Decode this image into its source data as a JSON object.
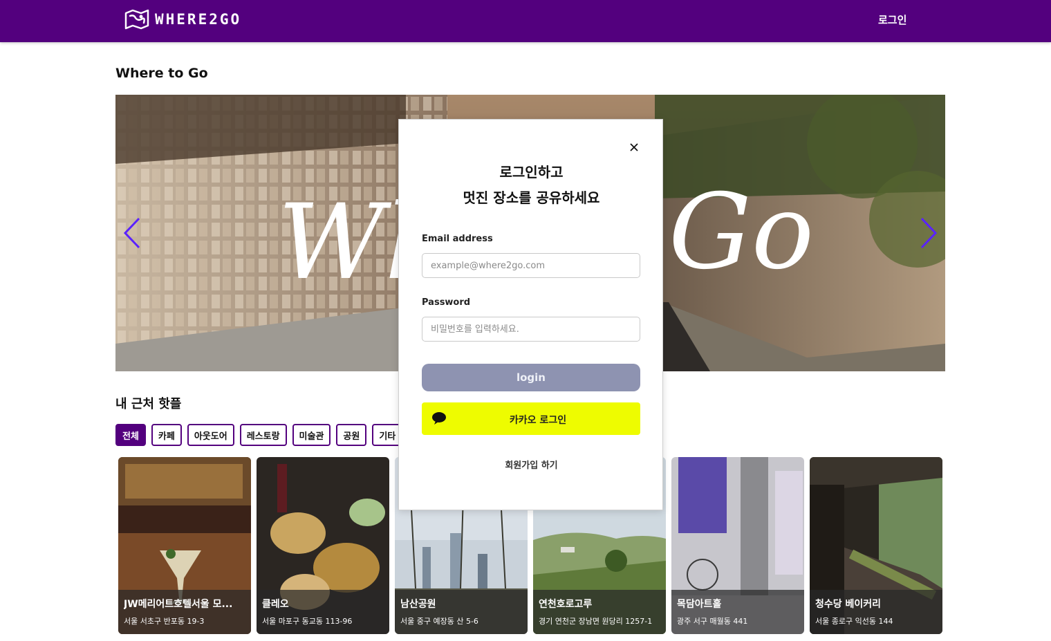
{
  "header": {
    "brand": "WHERE2GO",
    "login_label": "로그인"
  },
  "page": {
    "title": "Where to Go"
  },
  "hero": {
    "overlay_text_left": "Whe",
    "overlay_text_right": "Go"
  },
  "nearby": {
    "title": "내 근처 핫플",
    "categories": [
      {
        "label": "전체",
        "active": true
      },
      {
        "label": "카페"
      },
      {
        "label": "아웃도어"
      },
      {
        "label": "레스토랑"
      },
      {
        "label": "미술관"
      },
      {
        "label": "공원"
      },
      {
        "label": "기타"
      }
    ],
    "places": [
      {
        "name": "JW메리어트호텔서울 모...",
        "address": "서울 서초구 반포동 19-3"
      },
      {
        "name": "클레오",
        "address": "서울 마포구 동교동 113-96"
      },
      {
        "name": "남산공원",
        "address": "서울 중구 예장동 산 5-6"
      },
      {
        "name": "연천호로고루",
        "address": "경기 연천군 장남면 원당리 1257-1"
      },
      {
        "name": "목담아트홀",
        "address": "광주 서구 매월동 441"
      },
      {
        "name": "청수당 베이커리",
        "address": "서울 종로구 익선동 144"
      }
    ]
  },
  "modal": {
    "heading_line1": "로그인하고",
    "heading_line2": "멋진 장소를 공유하세요",
    "email_label": "Email address",
    "email_placeholder": "example@where2go.com",
    "password_label": "Password",
    "password_placeholder": "비밀번호를 입력하세요.",
    "login_button": "login",
    "kakao_button": "카카오 로그인",
    "signup_link": "회원가입 하기"
  },
  "colors": {
    "brand": "#53007e",
    "kakao": "#eefc00",
    "login_disabled": "#8e93b1",
    "arrow": "#5a22ff"
  }
}
